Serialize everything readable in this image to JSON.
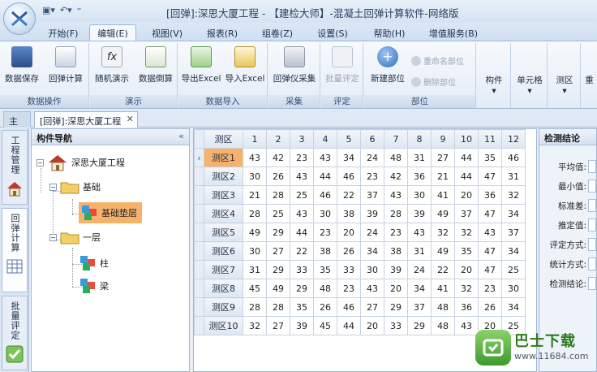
{
  "window": {
    "title": "[回弹]:深思大厦工程 - 【建检大师】-混凝土回弹计算软件-网络版"
  },
  "menu": {
    "tabs": [
      {
        "label": "开始(F)"
      },
      {
        "label": "编辑(E)"
      },
      {
        "label": "视图(V)"
      },
      {
        "label": "报表(R)"
      },
      {
        "label": "组卷(Z)"
      },
      {
        "label": "设置(S)"
      },
      {
        "label": "帮助(H)"
      },
      {
        "label": "增值服务(B)"
      }
    ],
    "active": "编辑(E)"
  },
  "ribbon": {
    "groups": [
      {
        "label": "数据操作",
        "buttons": [
          "数据保存",
          "回弹计算"
        ]
      },
      {
        "label": "演示",
        "buttons": [
          "随机演示",
          "数据倒算"
        ]
      },
      {
        "label": "数据导入",
        "buttons": [
          "导出Excel",
          "导入Excel"
        ]
      },
      {
        "label": "采集",
        "buttons": [
          "回弹仪采集"
        ]
      },
      {
        "label": "评定",
        "buttons": [
          "批量评定"
        ]
      },
      {
        "label": "部位",
        "buttons": [
          "新建部位"
        ],
        "small": [
          "重命名部位",
          "删除部位"
        ]
      }
    ],
    "dropdowns": [
      "构件",
      "单元格",
      "测区",
      "重"
    ]
  },
  "doc_tabs": {
    "home": "主页",
    "doc": "[回弹]:深思大厦工程"
  },
  "side_tabs": [
    "工程管理",
    "回弹计算",
    "批量评定"
  ],
  "nav": {
    "title": "构件导航",
    "collapse": "«",
    "tree": {
      "root": "深思大厦工程",
      "level1": [
        "基础",
        "一层"
      ],
      "foundation_children": [
        "基础垫层"
      ],
      "floor1_children": [
        "柱",
        "梁"
      ]
    }
  },
  "grid": {
    "corner": "测区",
    "columns": [
      "1",
      "2",
      "3",
      "4",
      "5",
      "6",
      "7",
      "8",
      "9",
      "10",
      "11",
      "12"
    ],
    "rows": [
      {
        "label": "测区1",
        "values": [
          43,
          42,
          23,
          43,
          34,
          24,
          48,
          31,
          27,
          44,
          35,
          46
        ]
      },
      {
        "label": "测区2",
        "values": [
          30,
          26,
          43,
          44,
          46,
          23,
          42,
          36,
          21,
          44,
          47,
          31
        ]
      },
      {
        "label": "测区3",
        "values": [
          21,
          28,
          25,
          46,
          22,
          37,
          43,
          30,
          41,
          20,
          36,
          32
        ]
      },
      {
        "label": "测区4",
        "values": [
          28,
          25,
          43,
          30,
          38,
          39,
          28,
          39,
          49,
          37,
          47,
          34
        ]
      },
      {
        "label": "测区5",
        "values": [
          49,
          29,
          44,
          23,
          20,
          24,
          23,
          43,
          32,
          32,
          43,
          37
        ]
      },
      {
        "label": "测区6",
        "values": [
          30,
          27,
          22,
          38,
          26,
          34,
          38,
          31,
          49,
          35,
          47,
          34
        ]
      },
      {
        "label": "测区7",
        "values": [
          31,
          29,
          33,
          35,
          33,
          30,
          39,
          24,
          22,
          20,
          47,
          25
        ]
      },
      {
        "label": "测区8",
        "values": [
          45,
          49,
          29,
          48,
          23,
          43,
          20,
          34,
          41,
          32,
          23,
          30
        ]
      },
      {
        "label": "测区9",
        "values": [
          28,
          28,
          35,
          26,
          46,
          27,
          29,
          37,
          48,
          36,
          26,
          34
        ]
      },
      {
        "label": "测区10",
        "values": [
          32,
          27,
          39,
          45,
          44,
          20,
          33,
          29,
          48,
          43,
          20,
          25
        ]
      }
    ]
  },
  "detect": {
    "title": "检测结论",
    "fields": [
      "平均值:",
      "最小值:",
      "标准差:",
      "推定值:",
      "评定方式:",
      "统计方式:",
      "检测结论:"
    ]
  },
  "watermark": {
    "title": "巴士下载",
    "url": "www.11684.com"
  },
  "colors": {
    "ribbon_bg": "#e3ecf7",
    "selected": "#f6b26b",
    "accent": "#9fb7d6"
  }
}
